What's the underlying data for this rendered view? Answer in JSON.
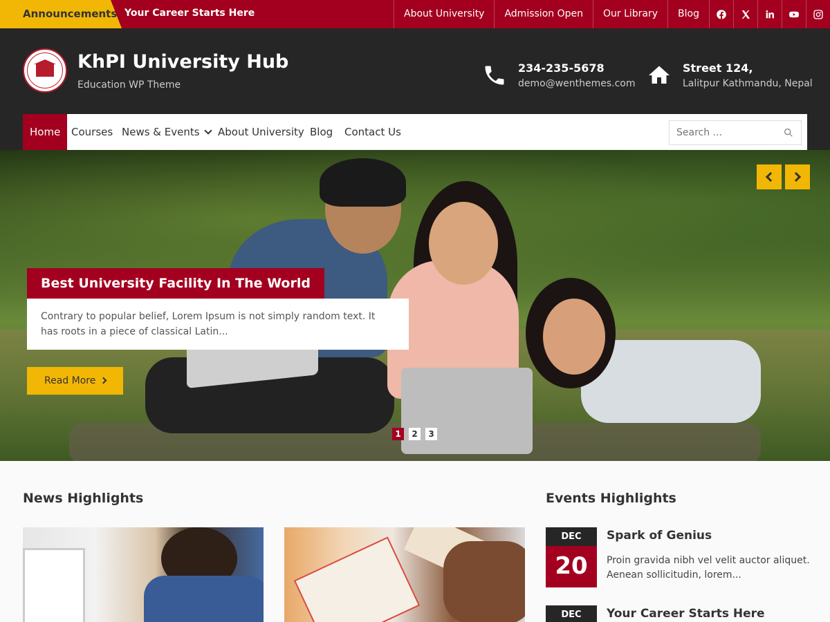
{
  "topbar": {
    "announcement_label": "Announcements:",
    "announcement_text": "Your Career Starts Here",
    "links": [
      "About University",
      "Admission Open",
      "Our Library",
      "Blog"
    ],
    "social_icons": [
      "facebook-icon",
      "x-icon",
      "linkedin-icon",
      "youtube-icon",
      "instagram-icon"
    ]
  },
  "header": {
    "site_title": "KhPI University Hub",
    "site_description": "Education WP Theme",
    "phone": "234-235-5678",
    "email": "demo@wenthemes.com",
    "address_line1": "Street 124,",
    "address_line2": "Lalitpur Kathmandu, Nepal"
  },
  "nav": {
    "items": [
      "Home",
      "Courses",
      "News & Events",
      "About University",
      "Blog",
      "Contact Us"
    ],
    "active": "Home",
    "search_placeholder": "Search ..."
  },
  "slider": {
    "title": "Best University Facility In The World",
    "text": "Contrary to popular belief, Lorem Ipsum is not simply random text. It has roots in a piece of classical Latin...",
    "button": "Read More",
    "pages": [
      "1",
      "2",
      "3"
    ],
    "active_page": "1"
  },
  "news": {
    "title": "News Highlights"
  },
  "events": {
    "title": "Events Highlights",
    "items": [
      {
        "month": "DEC",
        "day": "20",
        "title": "Spark of Genius",
        "desc": "Proin gravida nibh vel velit auctor aliquet. Aenean sollicitudin, lorem..."
      },
      {
        "month": "DEC",
        "day": "",
        "title": "Your Career Starts Here",
        "desc": ""
      }
    ]
  },
  "colors": {
    "primary": "#a3001f",
    "accent": "#f2b705",
    "dark": "#262626"
  }
}
